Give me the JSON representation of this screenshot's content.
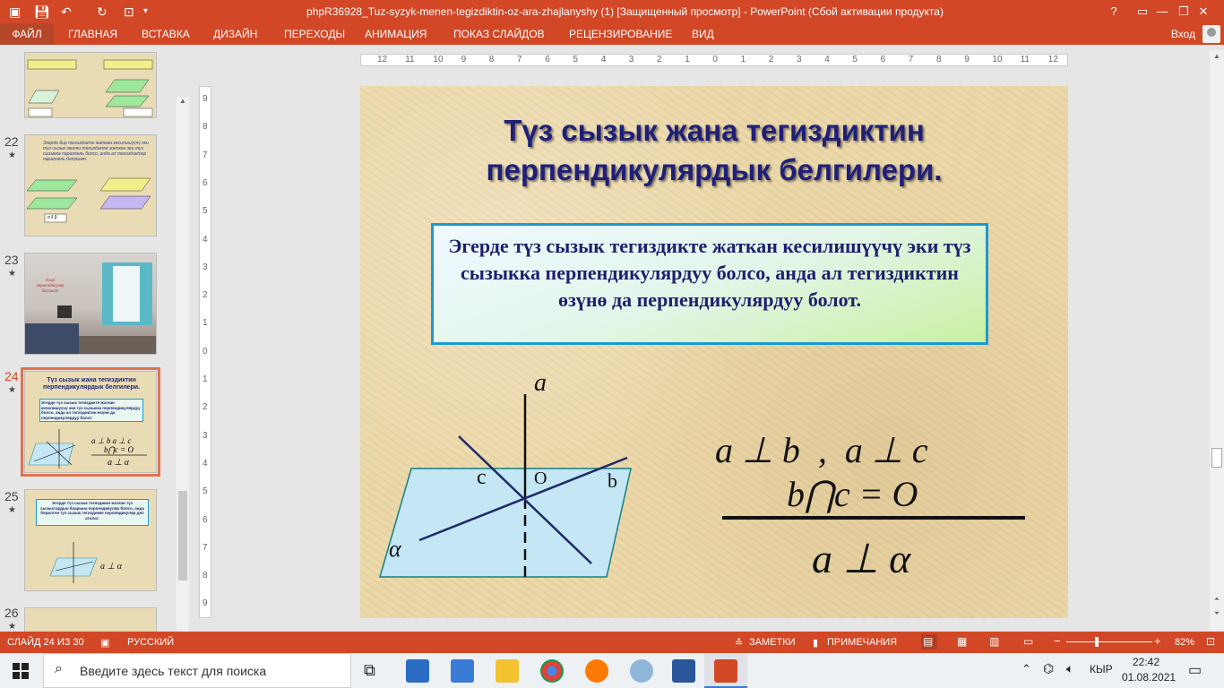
{
  "titlebar": {
    "title": "phpR36928_Tuz-syzyk-menen-tegizdiktin-oz-ara-zhajlanyshy (1) [Защищенный просмотр] -  PowerPoint (Сбой активации продукта)",
    "help": "?",
    "restore": "▭",
    "minimize": "—",
    "maximize": "❐",
    "close": "✕"
  },
  "ribbon": {
    "tabs": [
      "ФАЙЛ",
      "ГЛАВНАЯ",
      "ВСТАВКА",
      "ДИЗАЙН",
      "ПЕРЕХОДЫ",
      "АНИМАЦИЯ",
      "ПОКАЗ СЛАЙДОВ",
      "РЕЦЕНЗИРОВАНИЕ",
      "ВИД"
    ],
    "signin": "Вход"
  },
  "thumbnails": [
    {
      "number": "22",
      "text": "Эгерде бир тегиздикте жаткан кесилишүүчү эки түз сызык экинчи тегиздикте жаткан эки түз сызыкка параллель болсо, анда ал тегиздиктер параллель болушат.",
      "label": "α ‖ β"
    },
    {
      "number": "23",
      "text": "Алар перпендикуляр болушат"
    },
    {
      "number": "24",
      "title": "Түз сызык жана тегиздиктин перпендикулярдык белгилери.",
      "text": "Эгерде түз сызык тегиздикте жаткан кесилишүүчү эки түз сызыкка перпендикулярдуу болсо, анда ал тегиздиктин өзүнө да перпендикулярдуу болот."
    },
    {
      "number": "25",
      "text": "Эгерде түз сызык тегиздикке жаткан түз сызыктардын баарына перпендикуляр болсо, анда берилген түз сызык тегиздикке перпендикуляр деп аталат.",
      "label": "a ⊥ α"
    },
    {
      "number": "26"
    }
  ],
  "ruler": {
    "h_labels": [
      "12",
      "11",
      "10",
      "9",
      "8",
      "7",
      "6",
      "5",
      "4",
      "3",
      "2",
      "1",
      "0",
      "1",
      "2",
      "3",
      "4",
      "5",
      "6",
      "7",
      "8",
      "9",
      "10",
      "11",
      "12"
    ],
    "v_labels": [
      "9",
      "8",
      "7",
      "6",
      "5",
      "4",
      "3",
      "2",
      "1",
      "0",
      "1",
      "2",
      "3",
      "4",
      "5",
      "6",
      "7",
      "8",
      "9"
    ]
  },
  "slide": {
    "title": "Түз сызык жана тегиздиктин перпендикулярдык белгилери.",
    "rule": "Эгерде түз сызык тегиздикте жаткан кесилишүүчү эки түз сызыкка перпендикулярдуу болсо, анда ал тегиздиктин өзүнө да перпендикулярдуу болот.",
    "diagram_labels": {
      "a": "a",
      "b": "b",
      "c": "c",
      "o": "O",
      "plane": "α"
    },
    "formula": {
      "line1": "a ⊥ b  ,  a ⊥ c",
      "line2": "b⋂c = O",
      "result": "a ⊥ α"
    }
  },
  "statusbar": {
    "slide_counter": "СЛАЙД 24 ИЗ 30",
    "language": "РУССКИЙ",
    "notes": "ЗАМЕТКИ",
    "comments": "ПРИМЕЧАНИЯ",
    "zoom_minus": "−",
    "zoom_plus": "+",
    "zoom": "82%"
  },
  "taskbar": {
    "search_placeholder": "Введите здесь текст для поиска",
    "language": "КЫР",
    "time": "22:42",
    "date": "01.08.2021"
  },
  "colors": {
    "accent": "#d24726",
    "slide_title": "#1f1f7a",
    "box_border": "#1a9ad0",
    "plane_fill": "#c4e6f5"
  }
}
